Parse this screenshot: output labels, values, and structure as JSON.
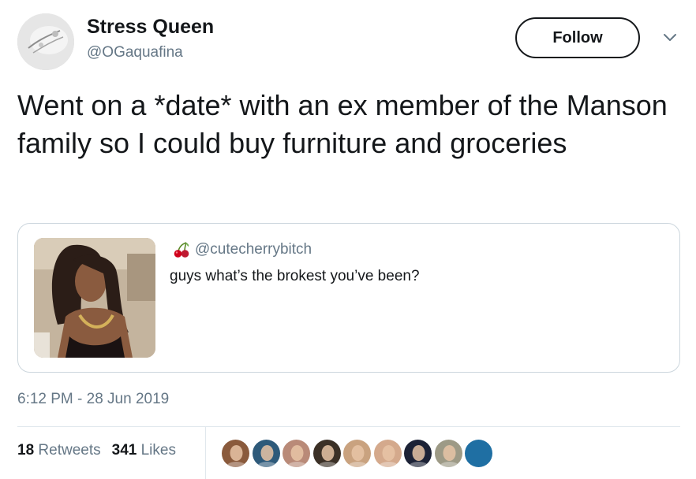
{
  "author": {
    "display_name": "Stress Queen",
    "handle": "@OGaquafina"
  },
  "actions": {
    "follow_label": "Follow",
    "more_icon": "chevron-down-icon"
  },
  "tweet": {
    "text": "Went on a *date* with an ex member of the Manson family so I could buy furniture and groceries",
    "timestamp": "6:12 PM - 28 Jun 2019"
  },
  "quoted_tweet": {
    "handle_icon": "cherry-icon",
    "handle": "@cutecherrybitch",
    "text": "guys what’s the brokest you’ve been?"
  },
  "stats": {
    "retweets_count": "18",
    "retweets_label": "Retweets",
    "likes_count": "341",
    "likes_label": "Likes"
  },
  "liker_avatars": [
    {
      "color": "#8a5a3c"
    },
    {
      "color": "#2e5a7a"
    },
    {
      "color": "#b98a78"
    },
    {
      "color": "#3b3026"
    },
    {
      "color": "#c9a27f"
    },
    {
      "color": "#d4a98c"
    },
    {
      "color": "#1c2236"
    },
    {
      "color": "#9d9a86"
    },
    {
      "color": "#1f6fa3"
    }
  ],
  "colors": {
    "text_primary": "#14171a",
    "text_secondary": "#657786",
    "border": "#ccd6dd"
  }
}
